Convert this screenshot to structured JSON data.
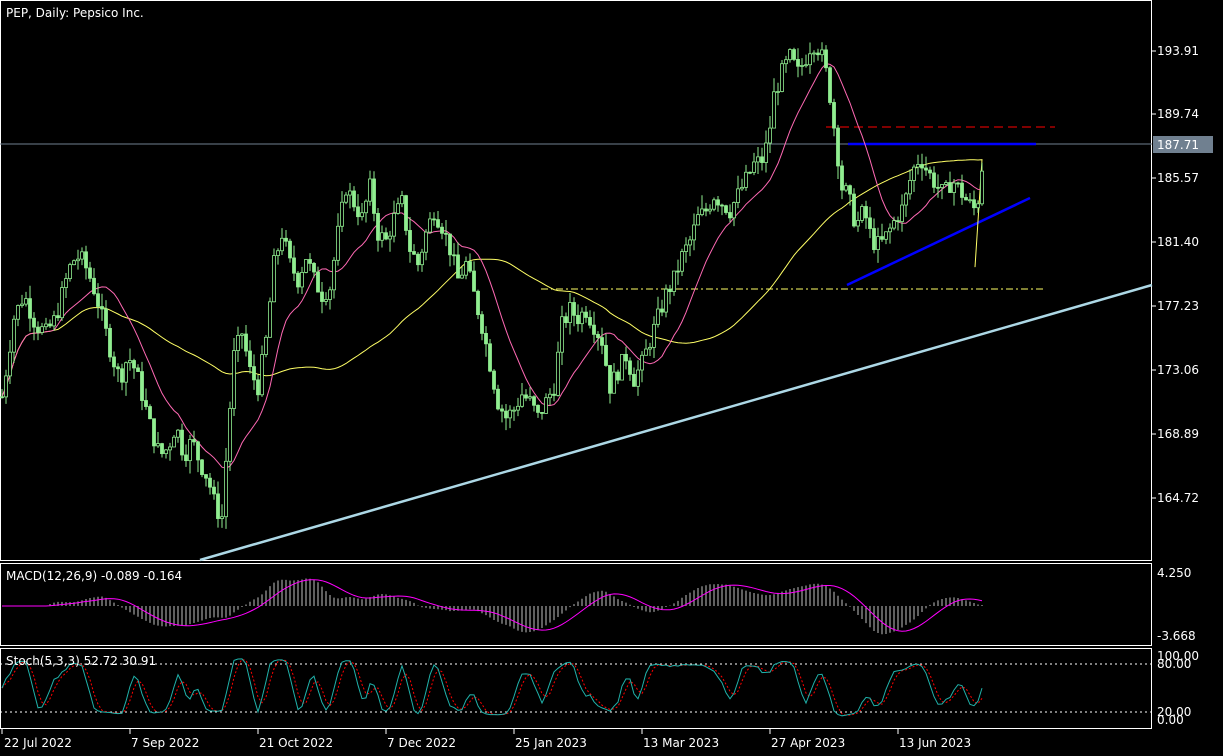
{
  "chart_data": {
    "type": "candlestick",
    "title": "PEP, Daily:  Pepsico Inc.",
    "price_axis": {
      "ticks": [
        "193.91",
        "189.74",
        "185.57",
        "181.40",
        "177.23",
        "173.06",
        "168.89",
        "164.72"
      ],
      "current_price": "187.71"
    },
    "time_axis": {
      "labels": [
        "22 Jul 2022",
        "7 Sep 2022",
        "21 Oct 2022",
        "7 Dec 2022",
        "25 Jan 2023",
        "13 Mar 2023",
        "27 Apr 2023",
        "13 Jun 2023"
      ]
    },
    "price_path": [
      [
        0,
        170.5
      ],
      [
        6,
        173
      ],
      [
        14,
        176.5
      ],
      [
        24,
        178
      ],
      [
        36,
        176
      ],
      [
        46,
        175.5
      ],
      [
        56,
        176.5
      ],
      [
        64,
        178.5
      ],
      [
        72,
        180.2
      ],
      [
        80,
        180.5
      ],
      [
        88,
        179.5
      ],
      [
        96,
        178
      ],
      [
        104,
        176
      ],
      [
        112,
        174
      ],
      [
        120,
        172.5
      ],
      [
        128,
        174
      ],
      [
        136,
        173
      ],
      [
        144,
        171
      ],
      [
        152,
        169
      ],
      [
        160,
        167.5
      ],
      [
        168,
        168
      ],
      [
        176,
        169.5
      ],
      [
        184,
        167.5
      ],
      [
        192,
        168.5
      ],
      [
        200,
        167
      ],
      [
        208,
        166
      ],
      [
        216,
        164
      ],
      [
        222,
        163.5
      ],
      [
        228,
        169
      ],
      [
        234,
        174
      ],
      [
        242,
        175.5
      ],
      [
        250,
        173
      ],
      [
        258,
        172
      ],
      [
        266,
        175
      ],
      [
        274,
        180
      ],
      [
        282,
        182
      ],
      [
        290,
        180
      ],
      [
        298,
        179
      ],
      [
        306,
        180.5
      ],
      [
        314,
        179
      ],
      [
        322,
        178
      ],
      [
        330,
        178.5
      ],
      [
        338,
        182
      ],
      [
        346,
        185
      ],
      [
        354,
        184
      ],
      [
        362,
        183
      ],
      [
        370,
        185
      ],
      [
        378,
        182
      ],
      [
        386,
        181.5
      ],
      [
        394,
        183
      ],
      [
        402,
        184
      ],
      [
        410,
        181
      ],
      [
        418,
        180
      ],
      [
        426,
        182
      ],
      [
        434,
        183.5
      ],
      [
        442,
        182.5
      ],
      [
        450,
        181
      ],
      [
        458,
        179
      ],
      [
        466,
        180
      ],
      [
        474,
        178
      ],
      [
        482,
        176
      ],
      [
        490,
        173.5
      ],
      [
        498,
        171
      ],
      [
        506,
        170
      ],
      [
        514,
        170.5
      ],
      [
        522,
        171.5
      ],
      [
        530,
        171
      ],
      [
        538,
        170
      ],
      [
        546,
        171
      ],
      [
        554,
        172
      ],
      [
        562,
        176
      ],
      [
        570,
        177
      ],
      [
        578,
        176.5
      ],
      [
        586,
        177
      ],
      [
        594,
        176
      ],
      [
        602,
        175
      ],
      [
        610,
        172
      ],
      [
        618,
        173
      ],
      [
        626,
        174
      ],
      [
        634,
        172.5
      ],
      [
        642,
        173.5
      ],
      [
        650,
        175
      ],
      [
        658,
        176.5
      ],
      [
        666,
        178
      ],
      [
        674,
        179
      ],
      [
        682,
        180.5
      ],
      [
        690,
        181.5
      ],
      [
        698,
        183
      ],
      [
        706,
        183.5
      ],
      [
        714,
        184.5
      ],
      [
        722,
        184
      ],
      [
        730,
        183.5
      ],
      [
        738,
        184.5
      ],
      [
        746,
        185.5
      ],
      [
        754,
        186.5
      ],
      [
        762,
        186.8
      ],
      [
        768,
        188
      ],
      [
        774,
        191
      ],
      [
        782,
        192.5
      ],
      [
        790,
        193.5
      ],
      [
        798,
        192.5
      ],
      [
        806,
        193.5
      ],
      [
        812,
        194.5
      ],
      [
        820,
        194
      ],
      [
        828,
        192
      ],
      [
        836,
        188
      ],
      [
        842,
        185
      ],
      [
        848,
        184.5
      ],
      [
        856,
        182.5
      ],
      [
        864,
        183.5
      ],
      [
        872,
        181.5
      ],
      [
        880,
        181.2
      ],
      [
        888,
        182
      ],
      [
        896,
        183
      ],
      [
        904,
        183.8
      ],
      [
        912,
        186
      ],
      [
        920,
        187
      ],
      [
        928,
        186
      ],
      [
        936,
        185.2
      ],
      [
        944,
        184.5
      ],
      [
        952,
        185.5
      ],
      [
        960,
        184.8
      ],
      [
        968,
        184
      ],
      [
        976,
        183.5
      ],
      [
        980,
        185
      ],
      [
        984,
        187.71
      ]
    ],
    "indicators": {
      "macd": {
        "label": "MACD(12,26,9) -0.089 -0.164",
        "ticks": [
          "4.250",
          "-3.668"
        ]
      },
      "stoch": {
        "label": "Stoch(5,3,3) 52.72 30.91",
        "ticks": [
          "100.00",
          "80.00",
          "20.00",
          "0.00"
        ]
      }
    },
    "colors": {
      "background": "#000000",
      "up_candle": "#90ee90",
      "ma_fast": "#ff69b4",
      "ma_slow": "#ffff66",
      "trendline_main": "#add8e6",
      "trendline_blue": "#0000ff",
      "resistance_dash": "#ff0000",
      "support_dash": "#ffff66",
      "macd_signal": "#ff00ff",
      "stoch_main": "#20b2aa",
      "stoch_signal": "#ff0000",
      "current_price_box": "#708090"
    }
  }
}
